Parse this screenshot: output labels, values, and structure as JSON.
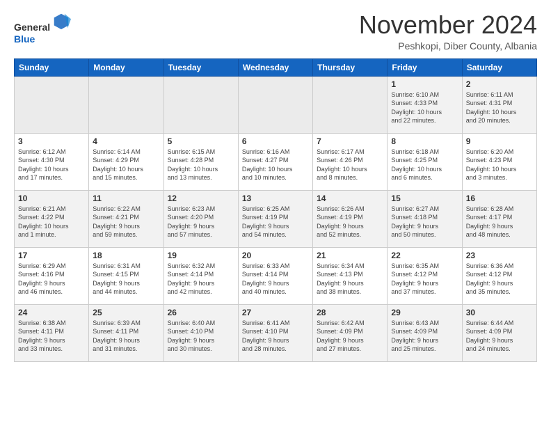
{
  "header": {
    "logo_line1": "General",
    "logo_line2": "Blue",
    "month": "November 2024",
    "location": "Peshkopi, Diber County, Albania"
  },
  "weekdays": [
    "Sunday",
    "Monday",
    "Tuesday",
    "Wednesday",
    "Thursday",
    "Friday",
    "Saturday"
  ],
  "weeks": [
    [
      {
        "day": "",
        "info": ""
      },
      {
        "day": "",
        "info": ""
      },
      {
        "day": "",
        "info": ""
      },
      {
        "day": "",
        "info": ""
      },
      {
        "day": "",
        "info": ""
      },
      {
        "day": "1",
        "info": "Sunrise: 6:10 AM\nSunset: 4:33 PM\nDaylight: 10 hours\nand 22 minutes."
      },
      {
        "day": "2",
        "info": "Sunrise: 6:11 AM\nSunset: 4:31 PM\nDaylight: 10 hours\nand 20 minutes."
      }
    ],
    [
      {
        "day": "3",
        "info": "Sunrise: 6:12 AM\nSunset: 4:30 PM\nDaylight: 10 hours\nand 17 minutes."
      },
      {
        "day": "4",
        "info": "Sunrise: 6:14 AM\nSunset: 4:29 PM\nDaylight: 10 hours\nand 15 minutes."
      },
      {
        "day": "5",
        "info": "Sunrise: 6:15 AM\nSunset: 4:28 PM\nDaylight: 10 hours\nand 13 minutes."
      },
      {
        "day": "6",
        "info": "Sunrise: 6:16 AM\nSunset: 4:27 PM\nDaylight: 10 hours\nand 10 minutes."
      },
      {
        "day": "7",
        "info": "Sunrise: 6:17 AM\nSunset: 4:26 PM\nDaylight: 10 hours\nand 8 minutes."
      },
      {
        "day": "8",
        "info": "Sunrise: 6:18 AM\nSunset: 4:25 PM\nDaylight: 10 hours\nand 6 minutes."
      },
      {
        "day": "9",
        "info": "Sunrise: 6:20 AM\nSunset: 4:23 PM\nDaylight: 10 hours\nand 3 minutes."
      }
    ],
    [
      {
        "day": "10",
        "info": "Sunrise: 6:21 AM\nSunset: 4:22 PM\nDaylight: 10 hours\nand 1 minute."
      },
      {
        "day": "11",
        "info": "Sunrise: 6:22 AM\nSunset: 4:21 PM\nDaylight: 9 hours\nand 59 minutes."
      },
      {
        "day": "12",
        "info": "Sunrise: 6:23 AM\nSunset: 4:20 PM\nDaylight: 9 hours\nand 57 minutes."
      },
      {
        "day": "13",
        "info": "Sunrise: 6:25 AM\nSunset: 4:19 PM\nDaylight: 9 hours\nand 54 minutes."
      },
      {
        "day": "14",
        "info": "Sunrise: 6:26 AM\nSunset: 4:19 PM\nDaylight: 9 hours\nand 52 minutes."
      },
      {
        "day": "15",
        "info": "Sunrise: 6:27 AM\nSunset: 4:18 PM\nDaylight: 9 hours\nand 50 minutes."
      },
      {
        "day": "16",
        "info": "Sunrise: 6:28 AM\nSunset: 4:17 PM\nDaylight: 9 hours\nand 48 minutes."
      }
    ],
    [
      {
        "day": "17",
        "info": "Sunrise: 6:29 AM\nSunset: 4:16 PM\nDaylight: 9 hours\nand 46 minutes."
      },
      {
        "day": "18",
        "info": "Sunrise: 6:31 AM\nSunset: 4:15 PM\nDaylight: 9 hours\nand 44 minutes."
      },
      {
        "day": "19",
        "info": "Sunrise: 6:32 AM\nSunset: 4:14 PM\nDaylight: 9 hours\nand 42 minutes."
      },
      {
        "day": "20",
        "info": "Sunrise: 6:33 AM\nSunset: 4:14 PM\nDaylight: 9 hours\nand 40 minutes."
      },
      {
        "day": "21",
        "info": "Sunrise: 6:34 AM\nSunset: 4:13 PM\nDaylight: 9 hours\nand 38 minutes."
      },
      {
        "day": "22",
        "info": "Sunrise: 6:35 AM\nSunset: 4:12 PM\nDaylight: 9 hours\nand 37 minutes."
      },
      {
        "day": "23",
        "info": "Sunrise: 6:36 AM\nSunset: 4:12 PM\nDaylight: 9 hours\nand 35 minutes."
      }
    ],
    [
      {
        "day": "24",
        "info": "Sunrise: 6:38 AM\nSunset: 4:11 PM\nDaylight: 9 hours\nand 33 minutes."
      },
      {
        "day": "25",
        "info": "Sunrise: 6:39 AM\nSunset: 4:11 PM\nDaylight: 9 hours\nand 31 minutes."
      },
      {
        "day": "26",
        "info": "Sunrise: 6:40 AM\nSunset: 4:10 PM\nDaylight: 9 hours\nand 30 minutes."
      },
      {
        "day": "27",
        "info": "Sunrise: 6:41 AM\nSunset: 4:10 PM\nDaylight: 9 hours\nand 28 minutes."
      },
      {
        "day": "28",
        "info": "Sunrise: 6:42 AM\nSunset: 4:09 PM\nDaylight: 9 hours\nand 27 minutes."
      },
      {
        "day": "29",
        "info": "Sunrise: 6:43 AM\nSunset: 4:09 PM\nDaylight: 9 hours\nand 25 minutes."
      },
      {
        "day": "30",
        "info": "Sunrise: 6:44 AM\nSunset: 4:09 PM\nDaylight: 9 hours\nand 24 minutes."
      }
    ]
  ]
}
